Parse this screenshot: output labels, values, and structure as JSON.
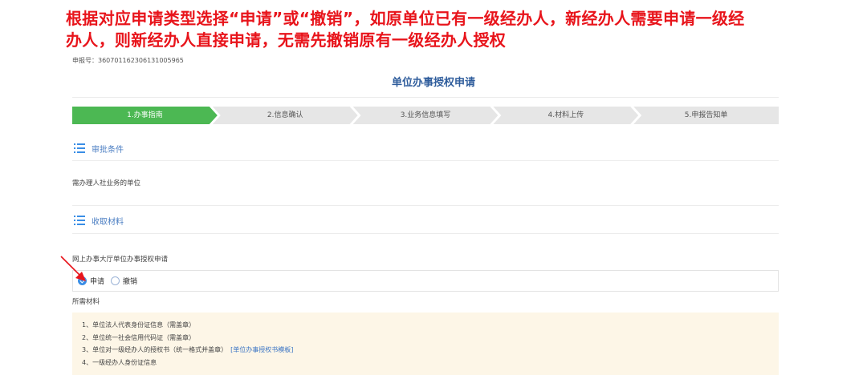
{
  "annotation": {
    "line1": "根据对应申请类型选择“申请”或“撤销”，如原单位已有一级经办人，新经办人需要申请一级经",
    "line2": "办人，则新经办人直接申请，无需先撤销原有一级经办人授权"
  },
  "apply_number": "申报号：360701162306131005965",
  "page_title": "单位办事授权申请",
  "steps": [
    {
      "label": "1.办事指南",
      "active": true
    },
    {
      "label": "2.信息确认",
      "active": false
    },
    {
      "label": "3.业务信息填写",
      "active": false
    },
    {
      "label": "4.材料上传",
      "active": false
    },
    {
      "label": "5.申报告知单",
      "active": false
    }
  ],
  "sections": {
    "approval_conditions": {
      "title": "审批条件",
      "text": "需办理人社业务的单位"
    },
    "materials": {
      "title": "收取材料"
    }
  },
  "hall_label": "网上办事大厅单位办事授权申请",
  "radio": {
    "options": [
      {
        "label": "申请",
        "checked": true
      },
      {
        "label": "撤销",
        "checked": false
      }
    ]
  },
  "required_label": "所需材料",
  "materials_list": [
    {
      "text": "1、单位法人代表身份证信息（需盖章）"
    },
    {
      "text": "2、单位统一社会信用代码证（需盖章）"
    },
    {
      "text": "3、单位对一级经办人的授权书（统一格式并盖章）",
      "link": "[单位办事授权书模板]"
    },
    {
      "text": "4、一级经办人身份证信息"
    }
  ],
  "colors": {
    "annotation": "#e8141b",
    "active_step": "#4cb853",
    "accent": "#3a8ee6",
    "material_bg": "#fdf6e7"
  }
}
